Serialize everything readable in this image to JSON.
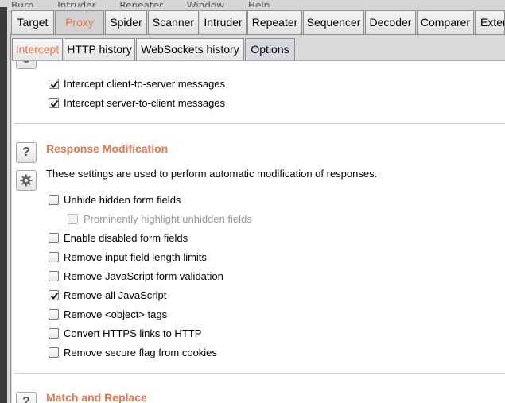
{
  "menubar": {
    "items": [
      "Burp",
      "Intruder",
      "Repeater",
      "Window",
      "Help"
    ]
  },
  "main_tabs": [
    {
      "label": "Target"
    },
    {
      "label": "Proxy"
    },
    {
      "label": "Spider"
    },
    {
      "label": "Scanner"
    },
    {
      "label": "Intruder"
    },
    {
      "label": "Repeater"
    },
    {
      "label": "Sequencer"
    },
    {
      "label": "Decoder"
    },
    {
      "label": "Comparer"
    },
    {
      "label": "Extende"
    }
  ],
  "sub_tabs": [
    {
      "label": "Intercept"
    },
    {
      "label": "HTTP history"
    },
    {
      "label": "WebSockets history"
    },
    {
      "label": "Options"
    }
  ],
  "intercept_ws": {
    "options": [
      {
        "label": "Intercept client-to-server messages",
        "checked": true
      },
      {
        "label": "Intercept server-to-client messages",
        "checked": true
      }
    ]
  },
  "response_modification": {
    "title": "Response Modification",
    "description": "These settings are used to perform automatic modification of responses.",
    "help_icon_glyph": "?",
    "options": [
      {
        "label": "Unhide hidden form fields",
        "checked": false
      },
      {
        "label": "Prominently highlight unhidden fields",
        "checked": false,
        "disabled": true
      },
      {
        "label": "Enable disabled form fields",
        "checked": false
      },
      {
        "label": "Remove input field length limits",
        "checked": false
      },
      {
        "label": "Remove JavaScript form validation",
        "checked": false
      },
      {
        "label": "Remove all JavaScript",
        "checked": true
      },
      {
        "label": "Remove <object> tags",
        "checked": false
      },
      {
        "label": "Convert HTTPS links to HTTP",
        "checked": false
      },
      {
        "label": "Remove secure flag from cookies",
        "checked": false
      }
    ]
  },
  "match_replace": {
    "title": "Match and Replace",
    "help_icon_glyph": "?"
  },
  "colors": {
    "accent": "#e8764a",
    "active_subtab": "#d6d9e0"
  }
}
